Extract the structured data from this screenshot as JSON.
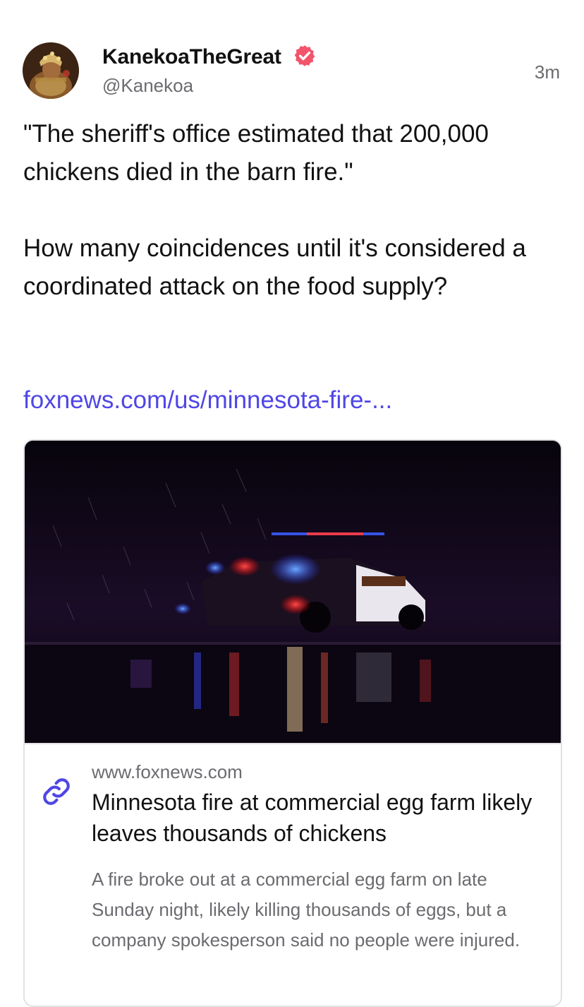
{
  "post": {
    "author": {
      "display_name": "KanekoaTheGreat",
      "handle": "@Kanekoa",
      "verified_icon": "verified-badge-icon",
      "avatar": "avatar-image"
    },
    "timestamp": "3m",
    "text_paragraphs": [
      "\"The sheriff's office estimated that 200,000 chickens died in the barn fire.\"",
      "How many coincidences until it's considered a coordinated attack on the food supply?"
    ],
    "link_text": "foxnews.com/us/minnesota-fire-...",
    "link_card": {
      "image": "sheriff-vehicle-night-photo",
      "domain": "www.foxnews.com",
      "title": "Minnesota fire at commercial egg farm likely leaves thousands of chickens",
      "description": "A fire broke out at a commercial egg farm on late Sunday night, likely killing thousands of eggs, but a company spokesperson said no people were injured.",
      "icon": "link-icon"
    }
  },
  "colors": {
    "link": "#4f46e5",
    "verified_badge": "#f2546b",
    "muted_text": "#6b6b70",
    "border": "#e2e2e6"
  }
}
